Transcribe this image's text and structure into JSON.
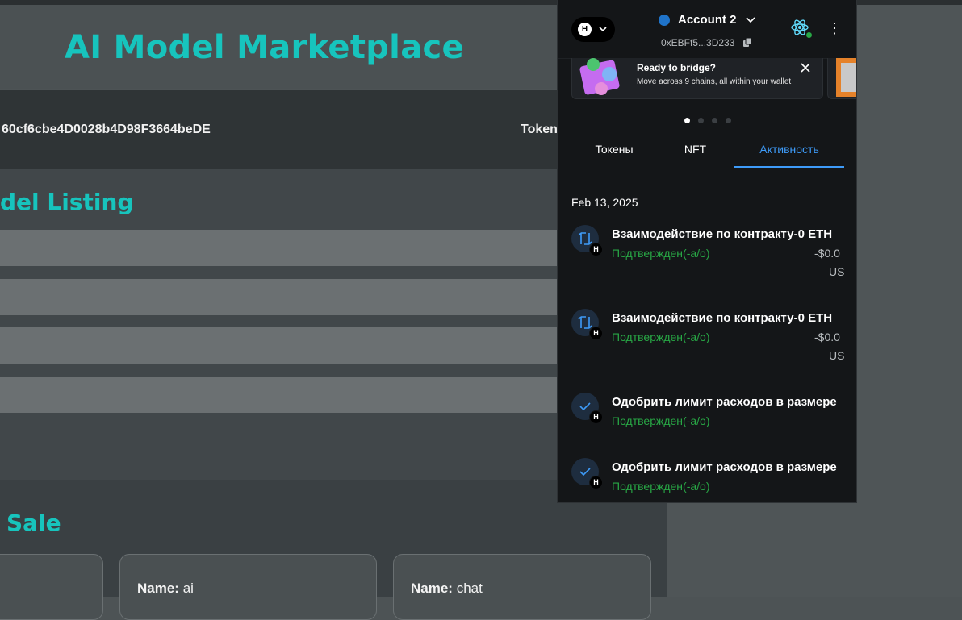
{
  "page": {
    "title": "AI Model Marketplace",
    "address": "60cf6cbe4D0028b4D98F3664beDE",
    "token_label": "Token",
    "listing_title": "del Listing",
    "sale_title": "Sale",
    "cards": [
      {
        "name_label": "Name:",
        "name_value": "ai"
      },
      {
        "name_label": "Name:",
        "name_value": "chat"
      }
    ]
  },
  "wallet": {
    "network_badge": "H",
    "account_name": "Account 2",
    "account_address": "0xEBFf5...3D233",
    "banner": {
      "title": "Ready to bridge?",
      "subtitle": "Move across 9 chains, all within your wallet"
    },
    "tabs": [
      "Токены",
      "NFT",
      "Активность"
    ],
    "active_tab": "Активность",
    "date": "Feb 13, 2025",
    "transactions": [
      {
        "title": "Взаимодействие по контракту-0 ETH",
        "status": "Подтвержден(-а/о)",
        "amount": "-$0.0",
        "currency": "US",
        "icon": "contract-interaction-icon",
        "badge": "H"
      },
      {
        "title": "Взаимодействие по контракту-0 ETH",
        "status": "Подтвержден(-а/о)",
        "amount": "-$0.0",
        "currency": "US",
        "icon": "contract-interaction-icon",
        "badge": "H"
      },
      {
        "title": "Одобрить лимит расходов в размере",
        "status": "Подтвержден(-а/о)",
        "icon": "check-icon",
        "badge": "H"
      },
      {
        "title": "Одобрить лимит расходов в размере",
        "status": "Подтвержден(-а/о)",
        "icon": "check-icon",
        "badge": "H"
      }
    ],
    "colors": {
      "accent": "#3e9bf8",
      "success": "#28a745",
      "background": "#141618",
      "brand_teal": "#17c4bd"
    }
  }
}
